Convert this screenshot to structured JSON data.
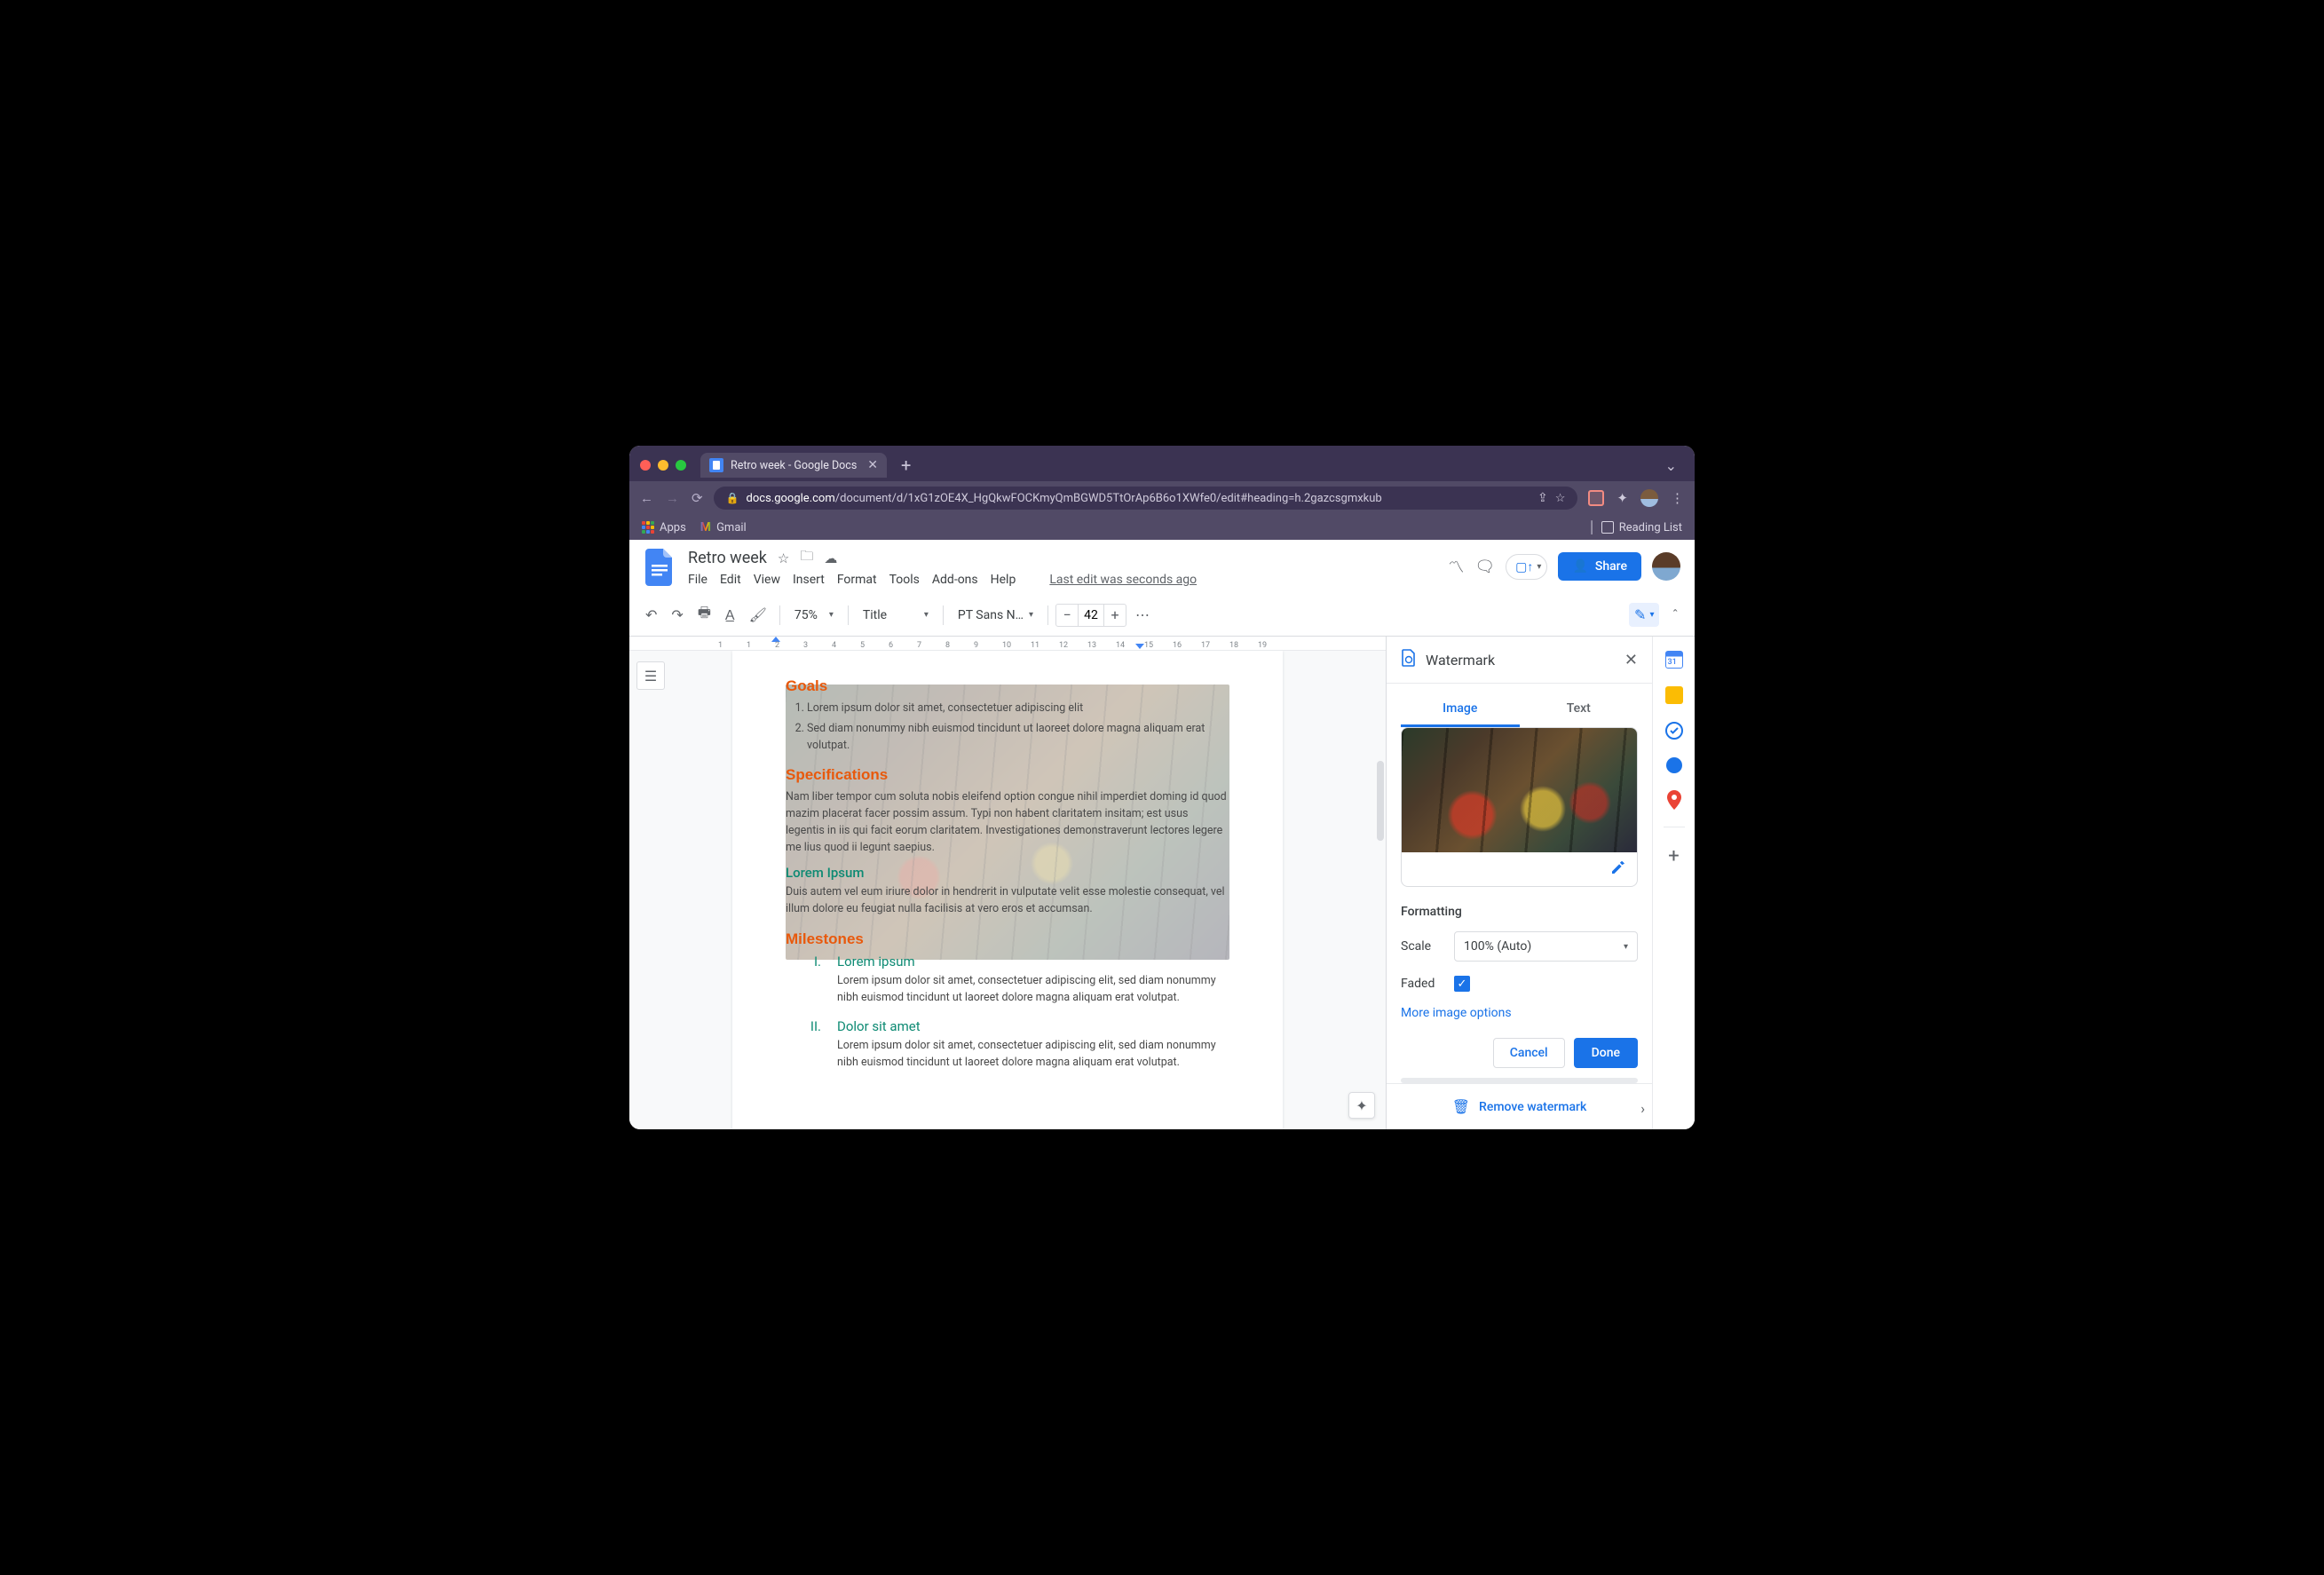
{
  "browser": {
    "tab_title": "Retro week - Google Docs",
    "url_host": "docs.google.com",
    "url_path": "/document/d/1xG1zOE4X_HgQkwFOCKmyQmBGWD5TtOrAp6B6o1XWfe0/edit#heading=h.2gazcsgmxkub",
    "apps_label": "Apps",
    "gmail_label": "Gmail",
    "reading_list_label": "Reading List"
  },
  "docs": {
    "title": "Retro week",
    "menus": [
      "File",
      "Edit",
      "View",
      "Insert",
      "Format",
      "Tools",
      "Add-ons",
      "Help"
    ],
    "last_edit": "Last edit was seconds ago",
    "share_label": "Share"
  },
  "toolbar": {
    "zoom": "75%",
    "style": "Title",
    "font": "PT Sans N…",
    "font_size": "42"
  },
  "ruler": {
    "ticks": [
      "1",
      "1",
      "2",
      "3",
      "4",
      "5",
      "6",
      "7",
      "8",
      "9",
      "10",
      "11",
      "12",
      "13",
      "14",
      "15",
      "16",
      "17",
      "18",
      "19"
    ]
  },
  "document": {
    "h_goals": "Goals",
    "goals": [
      "Lorem ipsum dolor sit amet, consectetuer adipiscing elit",
      "Sed diam nonummy nibh euismod tincidunt ut laoreet dolore magna aliquam erat volutpat."
    ],
    "h_specs": "Specifications",
    "specs_p": "Nam liber tempor cum soluta nobis eleifend option congue nihil imperdiet doming id quod mazim placerat facer possim assum. Typi non habent claritatem insitam; est usus legentis in iis qui facit eorum claritatem. Investigationes demonstraverunt lectores legere me lius quod ii legunt saepius.",
    "h_lorem": "Lorem Ipsum",
    "lorem_p": "Duis autem vel eum iriure dolor in hendrerit in vulputate velit esse molestie consequat, vel illum dolore eu feugiat nulla facilisis at vero eros et accumsan.",
    "h_milestones": "Milestones",
    "milestones": [
      {
        "num": "I.",
        "title": "Lorem ipsum",
        "body": "Lorem ipsum dolor sit amet, consectetuer adipiscing elit, sed diam nonummy nibh euismod tincidunt ut laoreet dolore magna aliquam erat volutpat."
      },
      {
        "num": "II.",
        "title": "Dolor sit amet",
        "body": "Lorem ipsum dolor sit amet, consectetuer adipiscing elit, sed diam nonummy nibh euismod tincidunt ut laoreet dolore magna aliquam erat volutpat."
      }
    ]
  },
  "watermark": {
    "panel_title": "Watermark",
    "tab_image": "Image",
    "tab_text": "Text",
    "formatting_label": "Formatting",
    "scale_label": "Scale",
    "scale_value": "100% (Auto)",
    "faded_label": "Faded",
    "faded_checked": true,
    "more_options": "More image options",
    "cancel": "Cancel",
    "done": "Done",
    "remove": "Remove watermark"
  }
}
